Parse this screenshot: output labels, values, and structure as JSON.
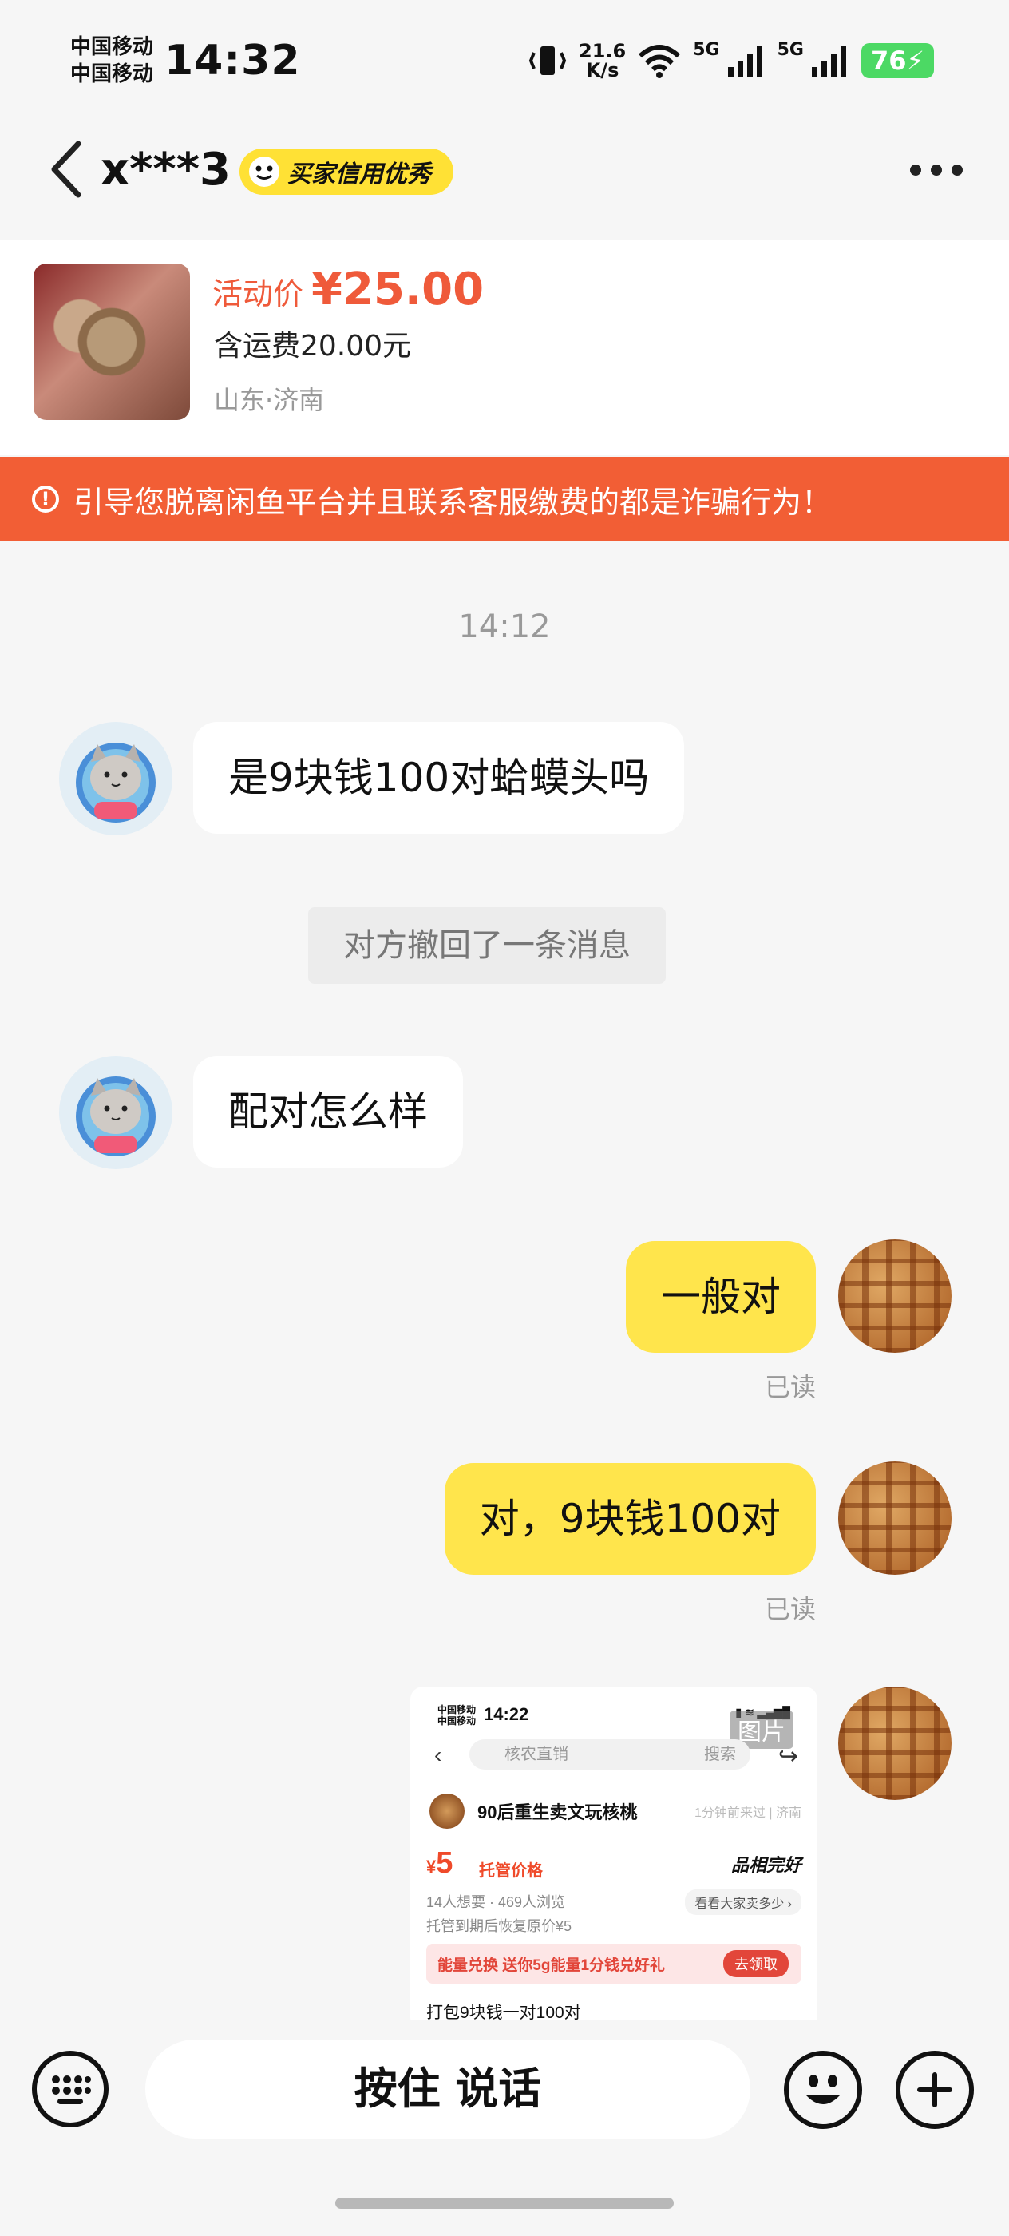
{
  "status_bar": {
    "carrier_1": "中国移动",
    "carrier_2": "中国移动",
    "time": "14:32",
    "net_speed_value": "21.6",
    "net_speed_unit": "K/s",
    "sig1_label": "5G",
    "sig2_label": "5G",
    "battery": "76"
  },
  "header": {
    "username": "x***3",
    "credit_badge": "买家信用优秀"
  },
  "product": {
    "price_label": "活动价",
    "price": "¥25.00",
    "shipping": "含运费20.00元",
    "location": "山东·济南"
  },
  "warning": {
    "text": "引导您脱离闲鱼平台并且联系客服缴费的都是诈骗行为！"
  },
  "chat": {
    "timestamp": "14:12",
    "messages": [
      {
        "side": "in",
        "text": "是9块钱100对蛤蟆头吗"
      },
      {
        "side": "system",
        "text": "对方撤回了一条消息"
      },
      {
        "side": "in",
        "text": "配对怎么样"
      },
      {
        "side": "out",
        "text": "一般对",
        "status": "已读"
      },
      {
        "side": "out",
        "text": "对，9块钱100对",
        "status": "已读"
      }
    ],
    "image_message": {
      "badge": "图片",
      "carrier_1": "中国移动",
      "carrier_2": "中国移动",
      "time": "14:22",
      "search_placeholder": "核农直销",
      "search_button": "搜索",
      "shop_name": "90后重生卖文玩核桃",
      "shop_meta": "1分钟前来过 | 济南",
      "price_symbol": "¥",
      "price": "5",
      "price_tag": "托管价格",
      "quality": "品相完好",
      "views": "14人想要 · 469人浏览",
      "compare": "看看大家卖多少 ›",
      "restore": "托管到期后恢复原价¥5",
      "promo": "能量兑换  送你5g能量1分钱兑好礼",
      "promo_button": "去领取",
      "description": "打包9块钱一对100对"
    }
  },
  "input_bar": {
    "voice_label": "按住 说话"
  }
}
